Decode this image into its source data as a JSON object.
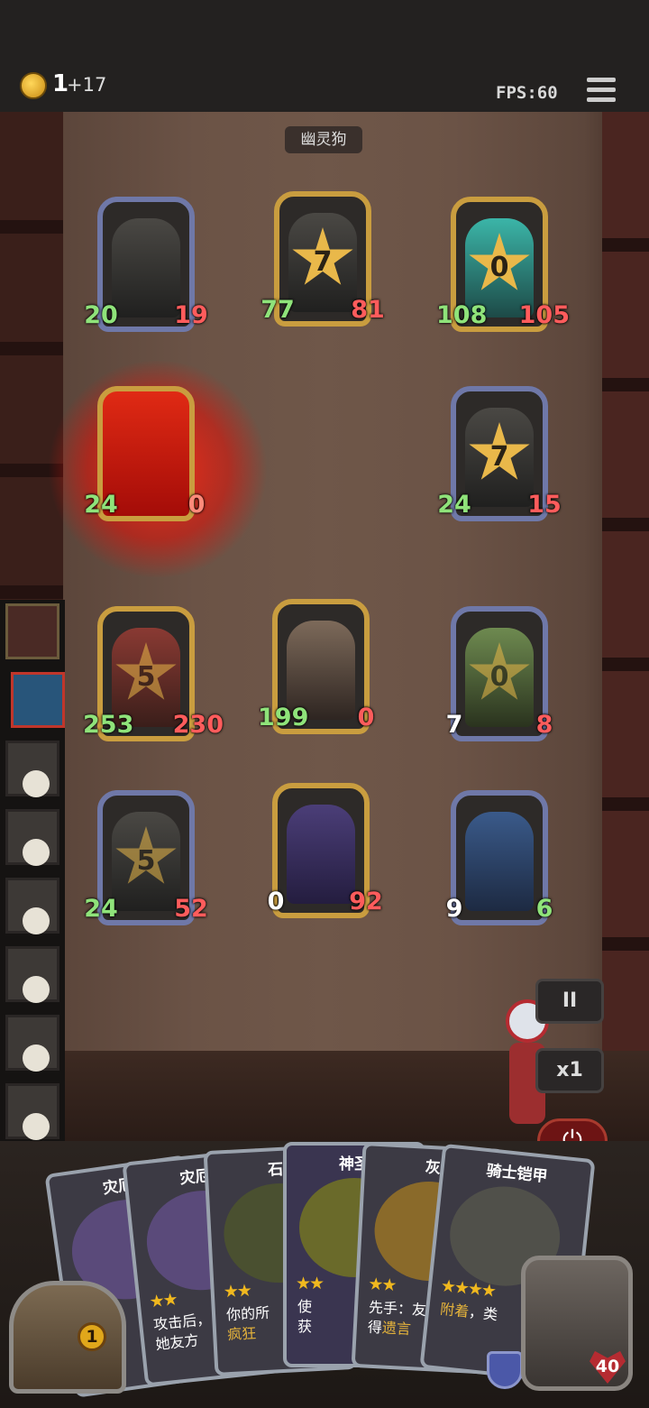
{
  "hud": {
    "coins": "1",
    "coin_income": "+17",
    "fps": "FPS:60"
  },
  "board": {
    "target_name": "幽灵狗",
    "enemy_units": [
      {
        "atk": "20",
        "hp": "19",
        "level": ""
      },
      {
        "atk": "77",
        "hp": "81",
        "level": "7"
      },
      {
        "atk": "108",
        "hp": "105",
        "level": "0"
      },
      {
        "atk": "24",
        "hp": "0",
        "level": ""
      },
      {
        "atk": "24",
        "hp": "15",
        "level": "7"
      }
    ],
    "player_units": [
      {
        "atk": "253",
        "hp": "230",
        "level": "5"
      },
      {
        "atk": "199",
        "hp": "0",
        "level": ""
      },
      {
        "atk": "7",
        "hp": "8",
        "level": "0"
      },
      {
        "atk": "24",
        "hp": "52",
        "level": "5"
      },
      {
        "atk": "0",
        "hp": "92",
        "level": ""
      },
      {
        "atk": "9",
        "hp": "6",
        "level": ""
      }
    ]
  },
  "controls": {
    "pause": "II",
    "speed": "x1",
    "power": "⏻"
  },
  "hand": [
    {
      "name": "灾厄",
      "stars": "★★",
      "desc": ""
    },
    {
      "name": "灾厄",
      "stars": "★★",
      "desc": "攻击后，",
      "desc2": "她友方"
    },
    {
      "name": "石",
      "stars": "★★",
      "desc": "你的所",
      "kw": "疯狂"
    },
    {
      "name": "神圣",
      "stars": "★★",
      "desc": "使",
      "desc2": "获"
    },
    {
      "name": "灰",
      "stars": "★★",
      "desc": "先手：友",
      "desc2": "得",
      "kw": "遗言"
    },
    {
      "name": "骑士铠甲",
      "stars": "★★★★",
      "kw": "附着",
      "desc": "，类"
    }
  ],
  "bottom": {
    "chest_count": "1",
    "life": "40"
  },
  "colors": {
    "gold_frame": "#c99d3f",
    "silver_frame": "#6f78a8",
    "attack": "#8fe37a",
    "health": "#ff5c5c",
    "glow": "#e02a14"
  }
}
